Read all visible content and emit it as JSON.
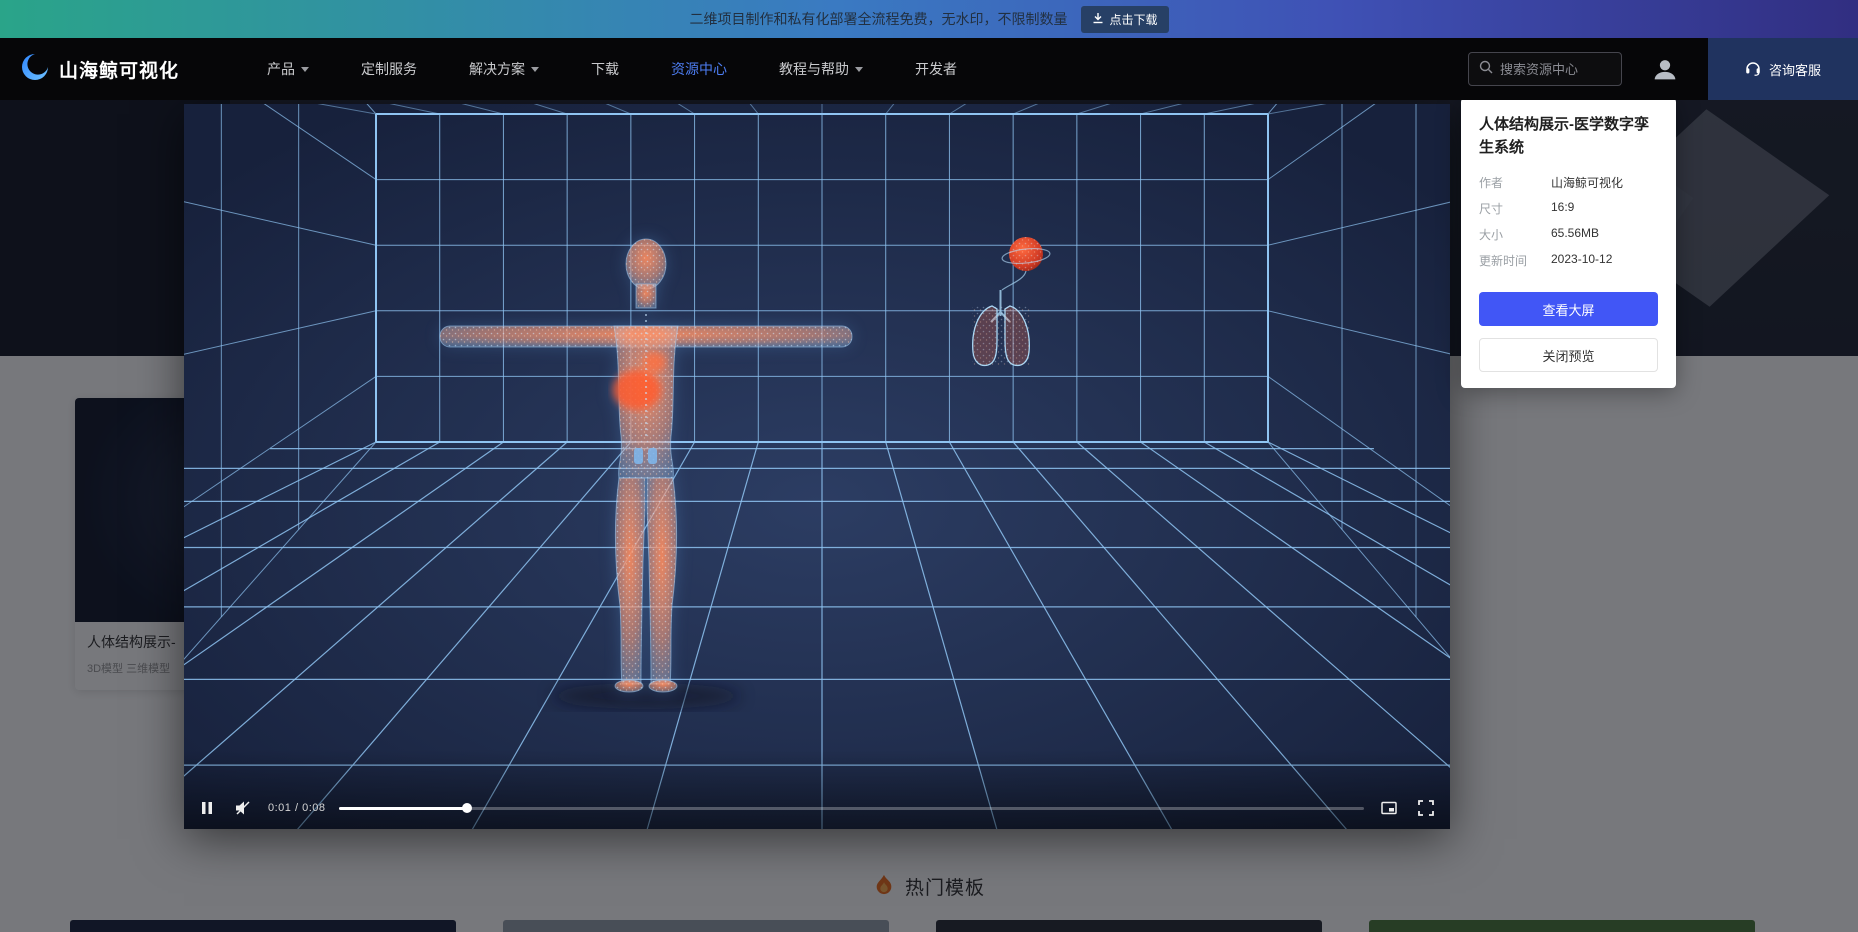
{
  "banner": {
    "text": "二维项目制作和私有化部署全流程免费，无水印，不限制数量",
    "button": "点击下载"
  },
  "nav": {
    "logo": "山海鲸可视化",
    "items": [
      {
        "label": "产品"
      },
      {
        "label": "定制服务"
      },
      {
        "label": "解决方案"
      },
      {
        "label": "下载"
      },
      {
        "label": "资源中心"
      },
      {
        "label": "教程与帮助"
      },
      {
        "label": "开发者"
      }
    ],
    "search_placeholder": "搜索资源中心",
    "service": "咨询客服"
  },
  "modal": {
    "info": {
      "title": "人体结构展示-医学数字孪生系统",
      "rows": [
        {
          "label": "作者",
          "value": "山海鲸可视化"
        },
        {
          "label": "尺寸",
          "value": "16:9"
        },
        {
          "label": "大小",
          "value": "65.56MB"
        },
        {
          "label": "更新时间",
          "value": "2023-10-12"
        }
      ],
      "primary_button": "查看大屏",
      "secondary_button": "关闭预览"
    },
    "player": {
      "time_label": "0:01 / 0:08",
      "progress_percent": 12.5
    }
  },
  "page_behind": {
    "card": {
      "title": "人体结构展示-",
      "tags": "3D模型 三维模型"
    },
    "section_title": "热门模板",
    "bottom_card_colors": [
      "#1d2742",
      "#97a2ae",
      "#2a3038",
      "#4f7d3f"
    ]
  },
  "colors": {
    "accent_blue": "#4156f6",
    "nav_active": "#4d7df2"
  }
}
